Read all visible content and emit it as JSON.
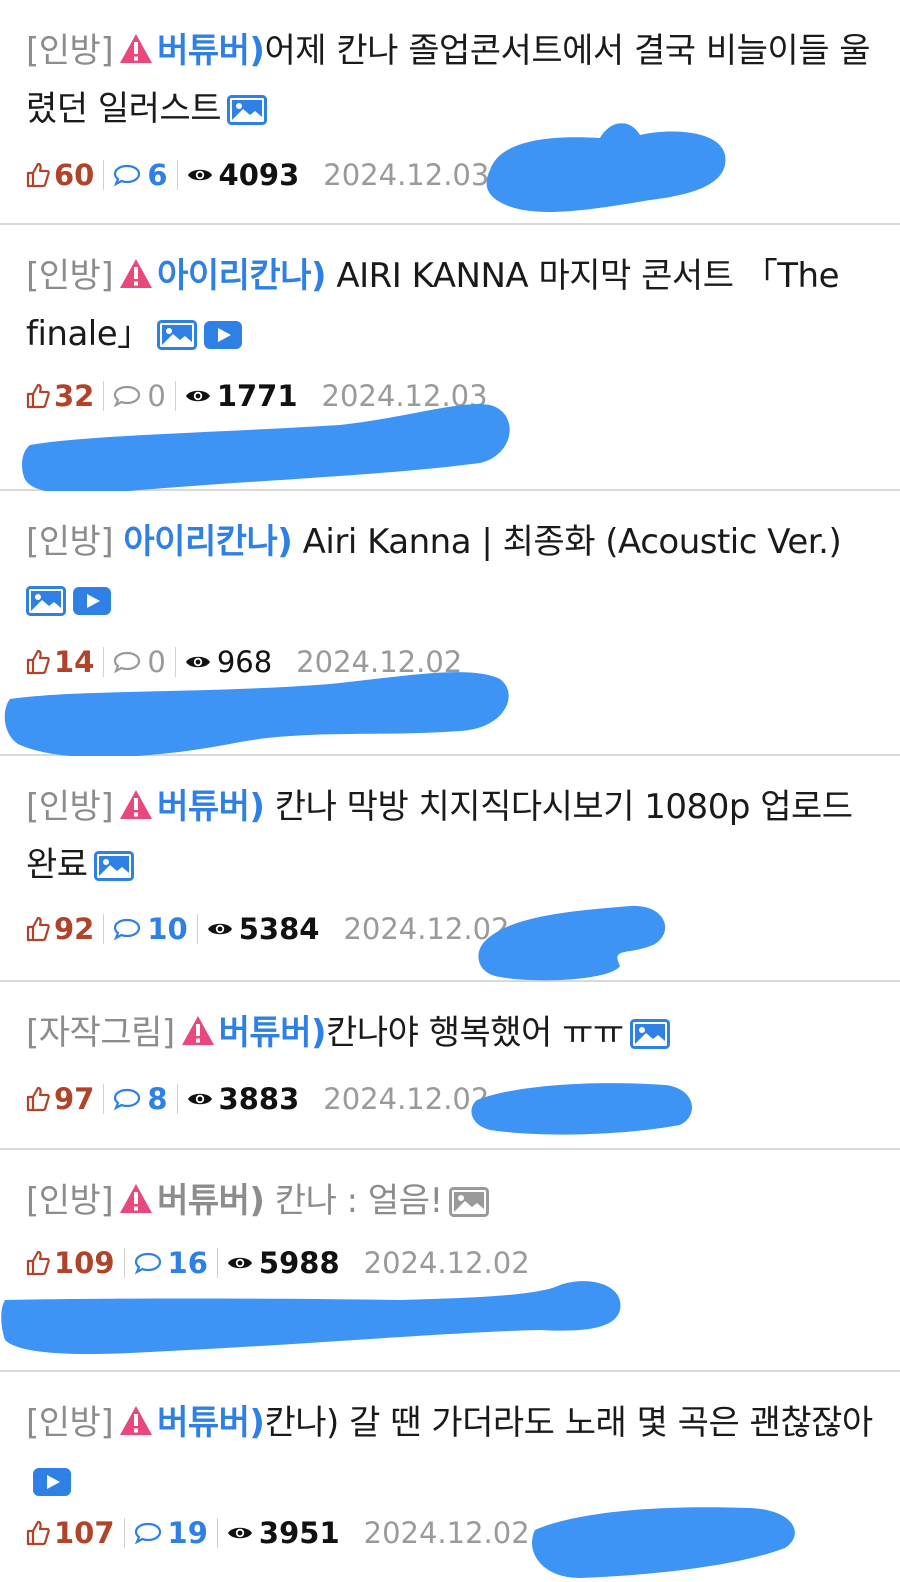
{
  "posts": [
    {
      "tag": "[인방]",
      "category": "버튜버)",
      "title": "어제 칸나 졸업콘서트에서 결국 비늘이들 울렸던 일러스트",
      "likes": "60",
      "comments": "6",
      "views": "4093",
      "date": "2024.12.03"
    },
    {
      "tag": "[인방]",
      "category": "아이리칸나)",
      "title": " AIRI KANNA 마지막 콘서트 「The finale」",
      "likes": "32",
      "comments": "0",
      "views": "1771",
      "date": "2024.12.03"
    },
    {
      "tag": "[인방]",
      "category": "아이리칸나)",
      "title": " Airi Kanna | 최종화 (Acoustic Ver.)",
      "likes": "14",
      "comments": "0",
      "views": "968",
      "date": "2024.12.02"
    },
    {
      "tag": "[인방]",
      "category": "버튜버)",
      "title": " 칸나 막방 치지직다시보기 1080p 업로드 완료",
      "likes": "92",
      "comments": "10",
      "views": "5384",
      "date": "2024.12.02"
    },
    {
      "tag": "[자작그림]",
      "category": "버튜버)",
      "title": "칸나야 행복했어 ㅠㅠ",
      "likes": "97",
      "comments": "8",
      "views": "3883",
      "date": "2024.12.02"
    },
    {
      "tag": "[인방]",
      "category": "버튜버)",
      "title": " 칸나 : 얼음!",
      "likes": "109",
      "comments": "16",
      "views": "5988",
      "date": "2024.12.02"
    },
    {
      "tag": "[인방]",
      "category": "버튜버)",
      "title": "칸나) 갈 땐 가더라도 노래 몇 곡은 괜찮잖아",
      "likes": "107",
      "comments": "19",
      "views": "3951",
      "date": "2024.12.02"
    }
  ],
  "colors": {
    "accent": "#2f80e4",
    "like": "#b0432a",
    "warning": "#e8497a",
    "scribble": "#3d94f5"
  }
}
